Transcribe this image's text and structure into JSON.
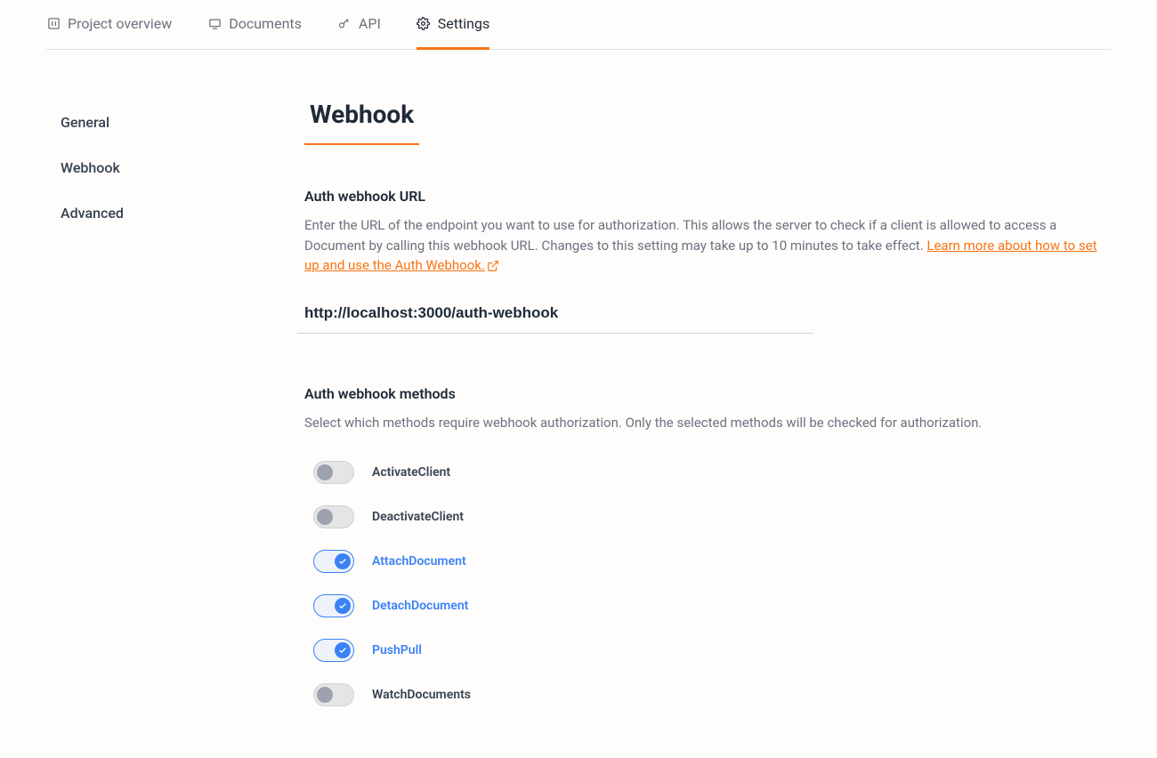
{
  "top_nav": {
    "items": [
      {
        "label": "Project overview"
      },
      {
        "label": "Documents"
      },
      {
        "label": "API"
      },
      {
        "label": "Settings"
      }
    ]
  },
  "sidebar": {
    "items": [
      {
        "label": "General"
      },
      {
        "label": "Webhook"
      },
      {
        "label": "Advanced"
      }
    ]
  },
  "page": {
    "heading": "Webhook"
  },
  "auth_url": {
    "title": "Auth webhook URL",
    "description": "Enter the URL of the endpoint you want to use for authorization. This allows the server to check if a client is allowed to access a Document by calling this webhook URL. Changes to this setting may take up to 10 minutes to take effect. ",
    "learn_more": "Learn more about how to set up and use the Auth Webhook.",
    "value": "http://localhost:3000/auth-webhook"
  },
  "auth_methods": {
    "title": "Auth webhook methods",
    "description": "Select which methods require webhook authorization. Only the selected methods will be checked for authorization.",
    "items": [
      {
        "label": "ActivateClient",
        "on": false
      },
      {
        "label": "DeactivateClient",
        "on": false
      },
      {
        "label": "AttachDocument",
        "on": true
      },
      {
        "label": "DetachDocument",
        "on": true
      },
      {
        "label": "PushPull",
        "on": true
      },
      {
        "label": "WatchDocuments",
        "on": false
      }
    ]
  }
}
